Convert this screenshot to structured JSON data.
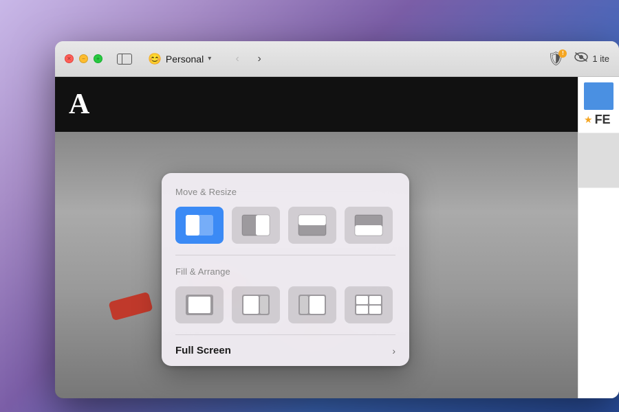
{
  "desktop": {
    "bg_color_start": "#c9b8e8",
    "bg_color_end": "#2a4fa0"
  },
  "window": {
    "title": "Personal"
  },
  "titlebar": {
    "traffic_lights": {
      "close_label": "×",
      "minimize_label": "−",
      "maximize_label": "+"
    },
    "sidebar_toggle_label": "",
    "folder_name": "Personal",
    "folder_chevron": "▾",
    "nav_back": "‹",
    "nav_forward": "›",
    "shield_warning": "!",
    "items_label": "1 ite",
    "items_icon": "👁️‍🗨️"
  },
  "popup": {
    "move_resize_label": "Move & Resize",
    "fill_arrange_label": "Fill & Arrange",
    "full_screen_label": "Full Screen",
    "full_screen_chevron": "›",
    "layout_icons": [
      {
        "id": "half-left",
        "active": true
      },
      {
        "id": "half-right",
        "active": false
      },
      {
        "id": "top-half",
        "active": false
      },
      {
        "id": "bottom-half",
        "active": false
      }
    ],
    "fill_icons": [
      {
        "id": "fill-full",
        "active": false
      },
      {
        "id": "fill-left-big",
        "active": false
      },
      {
        "id": "fill-right-big",
        "active": false
      },
      {
        "id": "fill-grid",
        "active": false
      }
    ]
  },
  "content": {
    "black_bar_text": "A",
    "fe_label": "FE",
    "star": "★"
  }
}
